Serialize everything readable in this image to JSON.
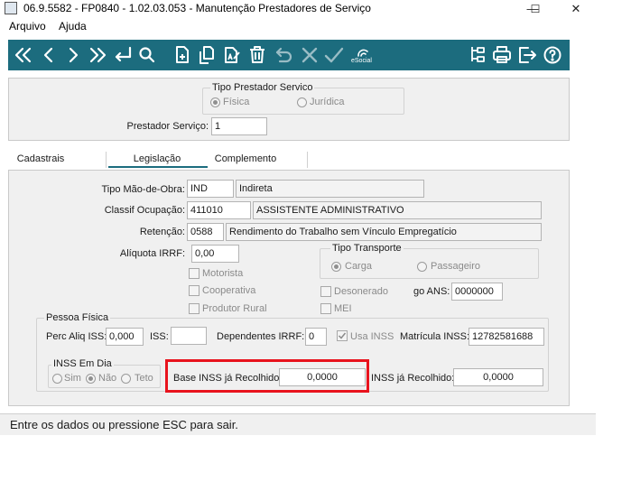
{
  "window": {
    "title": "06.9.5582 - FP0840 - 1.02.03.053 - Manutenção Prestadores de Serviço",
    "minimize": "—",
    "maximize": "☐",
    "close": "✕"
  },
  "menu": [
    "Arquivo",
    "Ajuda"
  ],
  "toolbar": {
    "icons": [
      "first-record-icon",
      "previous-record-icon",
      "next-record-icon",
      "last-record-icon",
      "goto-icon",
      "search-icon",
      "new-icon",
      "copy-icon",
      "edit-icon",
      "delete-icon",
      "undo-icon",
      "cancel-icon",
      "confirm-icon",
      "esocial-icon",
      "list-icon",
      "print-icon",
      "exit-icon",
      "help-icon"
    ],
    "esocial_label": "eSocial"
  },
  "header": {
    "tipo_group_title": "Tipo Prestador Servico",
    "fisica": "Física",
    "juridica": "Jurídica",
    "selected_tipo": "Física",
    "prestador_label": "Prestador Serviço:",
    "prestador_value": "1"
  },
  "tabs": [
    {
      "label": "Cadastrais",
      "active": false
    },
    {
      "label": "Legislação",
      "active": true
    },
    {
      "label": "Complemento",
      "active": false
    }
  ],
  "legislacao": {
    "tipo_mao_obra": {
      "label": "Tipo Mão-de-Obra:",
      "code": "IND",
      "desc": "Indireta"
    },
    "classif_ocupacao": {
      "label": "Classif Ocupação:",
      "code": "411010",
      "desc": "ASSISTENTE ADMINISTRATIVO"
    },
    "retencao": {
      "label": "Retenção:",
      "code": "0588",
      "desc": "Rendimento do Trabalho sem Vínculo Empregatício"
    },
    "aliquota_irrf": {
      "label": "Alíquota IRRF:",
      "value": "0,00"
    },
    "checks": {
      "motorista": "Motorista",
      "cooperativa": "Cooperativa",
      "produtor_rural": "Produtor Rural",
      "desonerado": "Desonerado",
      "mei": "MEI"
    },
    "tipo_transporte": {
      "title": "Tipo Transporte",
      "carga": "Carga",
      "passageiro": "Passageiro",
      "selected": "Carga"
    },
    "codigo_ans": {
      "label": "go ANS:",
      "value": "0000000"
    }
  },
  "pessoa_fisica": {
    "title": "Pessoa Física",
    "perc_aliq_iss": {
      "label": "Perc Aliq ISS:",
      "value": "0,000"
    },
    "iss": {
      "label": "ISS:",
      "value": ""
    },
    "dependentes_irrf": {
      "label": "Dependentes IRRF:",
      "value": "0"
    },
    "usa_inss": "Usa INSS",
    "matricula_inss": {
      "label": "Matrícula INSS:",
      "value": "12782581688"
    },
    "inss_em_dia": {
      "title": "INSS Em Dia",
      "sim": "Sim",
      "nao": "Não",
      "teto": "Teto",
      "selected": "Não"
    },
    "base_inss_recolhido": {
      "label": "Base INSS já Recolhido:",
      "value": "0,0000"
    },
    "inss_recolhido": {
      "label": "INSS já Recolhido:",
      "value": "0,0000"
    }
  },
  "status": "Entre os dados ou pressione ESC para sair.",
  "colors": {
    "toolbar": "#1c6c7e",
    "highlight": "#e8131d",
    "tab_active_underline": "#1c6c7e"
  }
}
